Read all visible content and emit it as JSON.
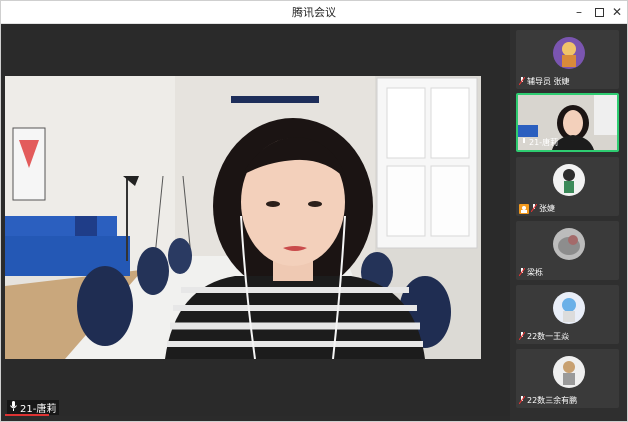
{
  "window": {
    "title": "腾讯会议",
    "controls": [
      "minimize",
      "maximize",
      "close"
    ]
  },
  "main_video": {
    "speaker_label": "21-唐莉",
    "mic_icon": "microphone-icon"
  },
  "participants": [
    {
      "label": "辅导员 张婕",
      "avatar": "purple-avatar",
      "active": false
    },
    {
      "label": "21-唐莉",
      "avatar": "video-thumbnail",
      "active": true
    },
    {
      "label": "张婕",
      "avatar": "character-avatar",
      "active": false,
      "host_badge": true
    },
    {
      "label": "梁栎",
      "avatar": "cat-avatar",
      "active": false
    },
    {
      "label": "22数一王焱",
      "avatar": "anime-avatar",
      "active": false
    },
    {
      "label": "22数三余有鹏",
      "avatar": "figure-avatar",
      "active": false
    }
  ],
  "colors": {
    "active_border": "#2ecc71",
    "host_badge": "#f39a1e",
    "speaker_underline": "#dd3333"
  }
}
